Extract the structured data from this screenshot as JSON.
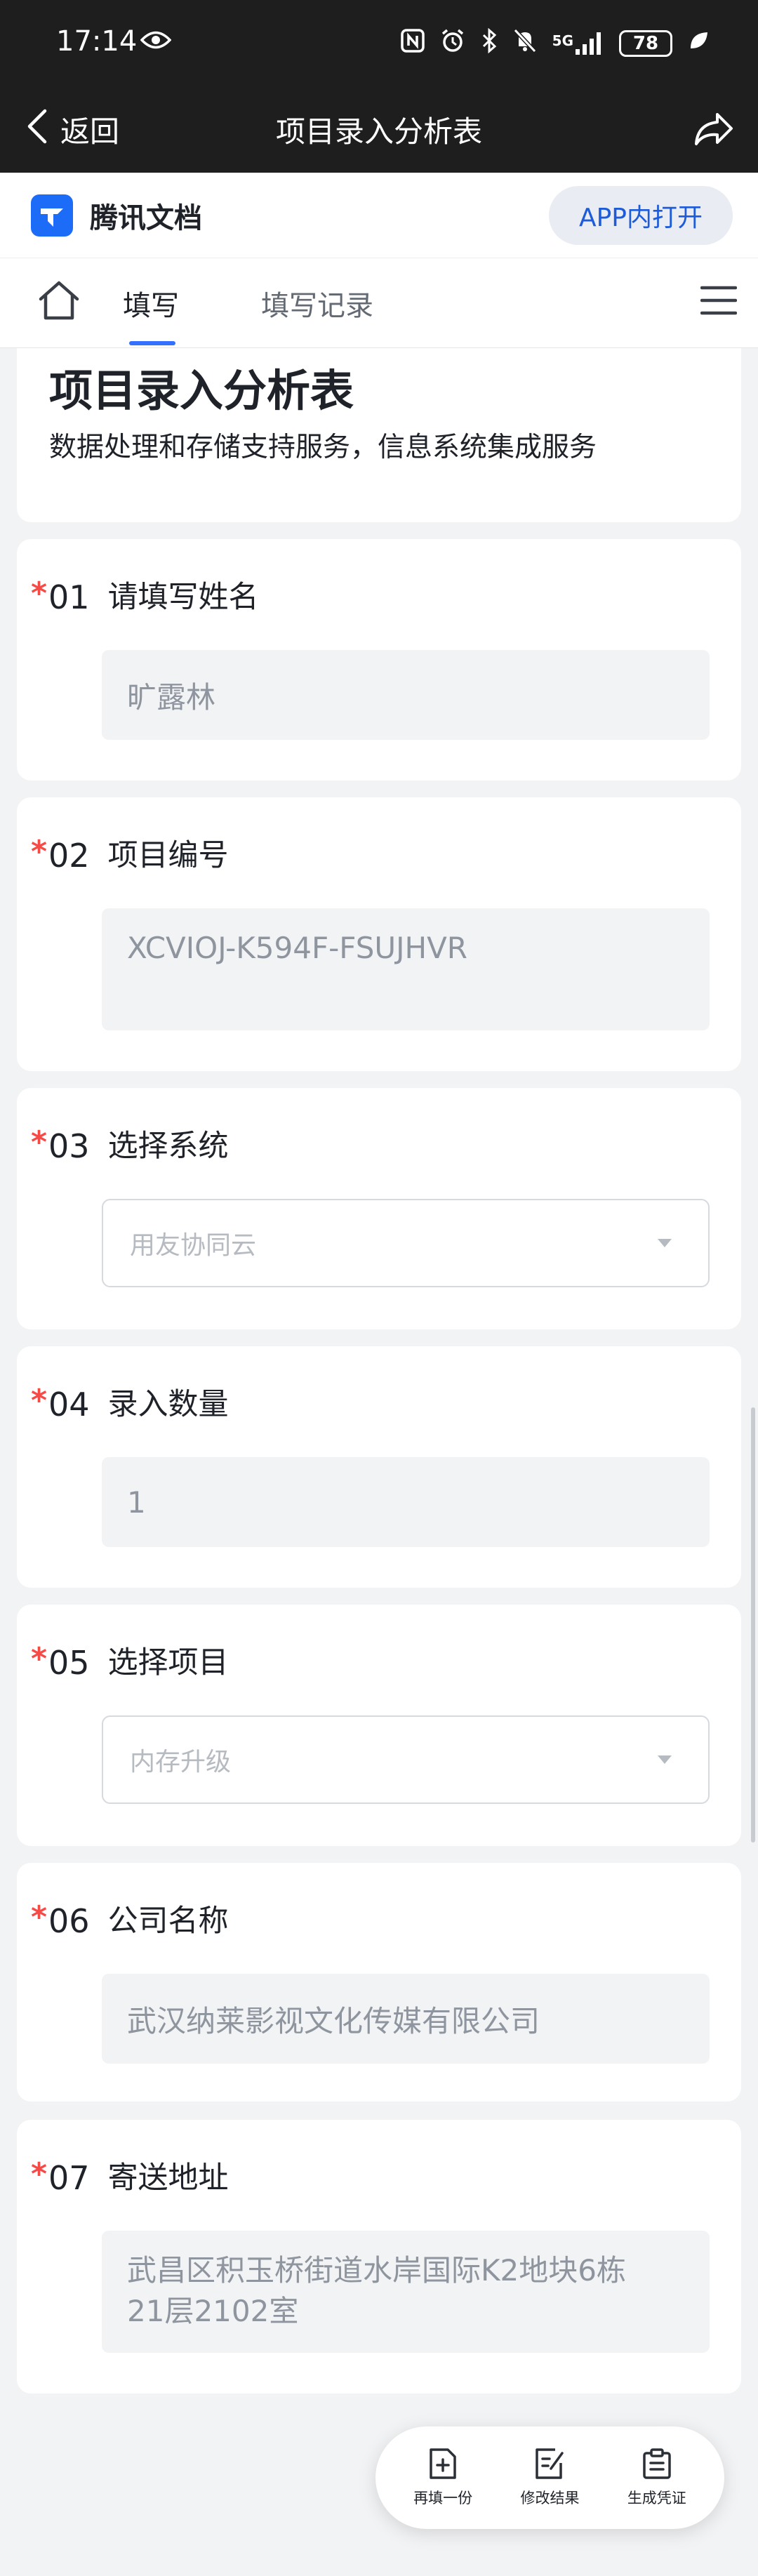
{
  "status_bar": {
    "time": "17:14",
    "network": "5G",
    "battery": "78"
  },
  "nav": {
    "back_label": "返回",
    "title": "项目录入分析表"
  },
  "brand": {
    "name": "腾讯文档",
    "open_app_label": "APP内打开"
  },
  "tabs": [
    {
      "label": "填写",
      "active": true
    },
    {
      "label": "填写记录",
      "active": false
    }
  ],
  "form": {
    "title": "项目录入分析表",
    "description": "数据处理和存储支持服务，信息系统集成服务",
    "questions": [
      {
        "required_mark": "*",
        "number": "01",
        "title": "请填写姓名",
        "type": "text",
        "value": "旷露林"
      },
      {
        "required_mark": "*",
        "number": "02",
        "title": "项目编号",
        "type": "text",
        "value": "XCVIOJ-K594F-FSUJHVR"
      },
      {
        "required_mark": "*",
        "number": "03",
        "title": "选择系统",
        "type": "select",
        "value": "用友协同云"
      },
      {
        "required_mark": "*",
        "number": "04",
        "title": "录入数量",
        "type": "text",
        "value": "1"
      },
      {
        "required_mark": "*",
        "number": "05",
        "title": "选择项目",
        "type": "select",
        "value": "内存升级"
      },
      {
        "required_mark": "*",
        "number": "06",
        "title": "公司名称",
        "type": "text",
        "value": "武汉纳莱影视文化传媒有限公司"
      },
      {
        "required_mark": "*",
        "number": "07",
        "title": "寄送地址",
        "type": "textarea",
        "value_lines": [
          "武昌区积玉桥街道水岸国际K2地块6栋",
          "21层2102室"
        ]
      }
    ]
  },
  "fab": {
    "refill_label": "再填一份",
    "edit_label": "修改结果",
    "voucher_label": "生成凭证"
  },
  "colors": {
    "accent": "#3370ff",
    "required": "#f54a45",
    "header_bg": "#1e1e1e",
    "page_bg": "#f2f3f5"
  }
}
